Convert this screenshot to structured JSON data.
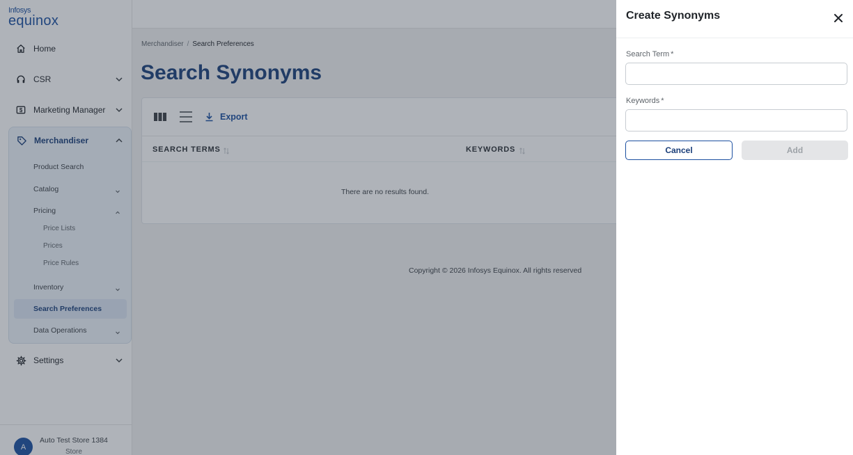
{
  "logo": {
    "line1": "Infosys",
    "line2": "equinox"
  },
  "sidebar": {
    "items": [
      {
        "label": "Home",
        "icon": "home-icon"
      },
      {
        "label": "CSR",
        "icon": "headset-icon"
      },
      {
        "label": "Marketing Manager",
        "icon": "dollar-icon"
      },
      {
        "label": "Merchandiser",
        "icon": "tag-icon"
      },
      {
        "label": "Settings",
        "icon": "gear-icon"
      }
    ],
    "merchandiser": {
      "product_search": "Product Search",
      "catalog": "Catalog",
      "pricing": "Pricing",
      "price_lists": "Price Lists",
      "prices": "Prices",
      "price_rules": "Price Rules",
      "inventory": "Inventory",
      "search_preferences": "Search Preferences",
      "data_operations": "Data Operations"
    }
  },
  "user": {
    "initial": "A",
    "name": "Auto Test Store 1384",
    "role": "Store"
  },
  "breadcrumb": {
    "parent": "Merchandiser",
    "separator": "/",
    "current": "Search Preferences"
  },
  "page": {
    "title": "Search Synonyms"
  },
  "toolbar": {
    "export_label": "Export"
  },
  "table": {
    "columns": [
      "SEARCH TERMS",
      "KEYWORDS"
    ],
    "empty_message": "There are no results found."
  },
  "footer": {
    "copyright": "Copyright © 2026 Infosys Equinox. All rights reserved"
  },
  "drawer": {
    "title": "Create Synonyms",
    "search_term_label": "Search Term",
    "search_term_value": "",
    "keywords_label": "Keywords",
    "keywords_value": "",
    "required_mark": "*",
    "cancel_label": "Cancel",
    "add_label": "Add"
  },
  "colors": {
    "brand": "#1b4fa0",
    "title": "#1b3f7a",
    "overlay": "rgba(45,55,72,0.38)",
    "disabled_button": "#e4e5e7"
  }
}
